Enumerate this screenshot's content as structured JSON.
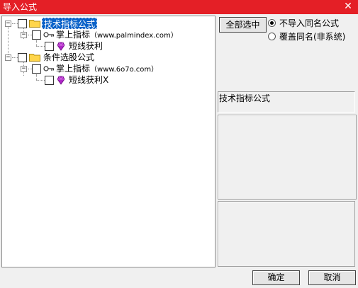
{
  "window": {
    "title": "导入公式",
    "close_glyph": "✕"
  },
  "tree": {
    "nodes": [
      {
        "label": "技术指标公式",
        "selected": true
      },
      {
        "label": "掌上指标",
        "url": "（www.palmindex.com）"
      },
      {
        "label": "短线获利"
      },
      {
        "label": "条件选股公式"
      },
      {
        "label": "掌上指标",
        "url": "（www.6o7o.com）"
      },
      {
        "label": "短线获利X"
      }
    ],
    "expander_glyph": "−"
  },
  "options": {
    "select_all_label": "全部选中",
    "radio_no_import": "不导入同名公式",
    "radio_overwrite": "覆盖同名(非系统)",
    "selected_radio": "no_import"
  },
  "info": {
    "formula_name": "技术指标公式"
  },
  "buttons": {
    "ok": "确定",
    "cancel": "取消"
  },
  "colors": {
    "titlebar": "#e41f26",
    "selection": "#0a62c9",
    "folder": "#ffd54a",
    "gem": "#b026c8"
  }
}
